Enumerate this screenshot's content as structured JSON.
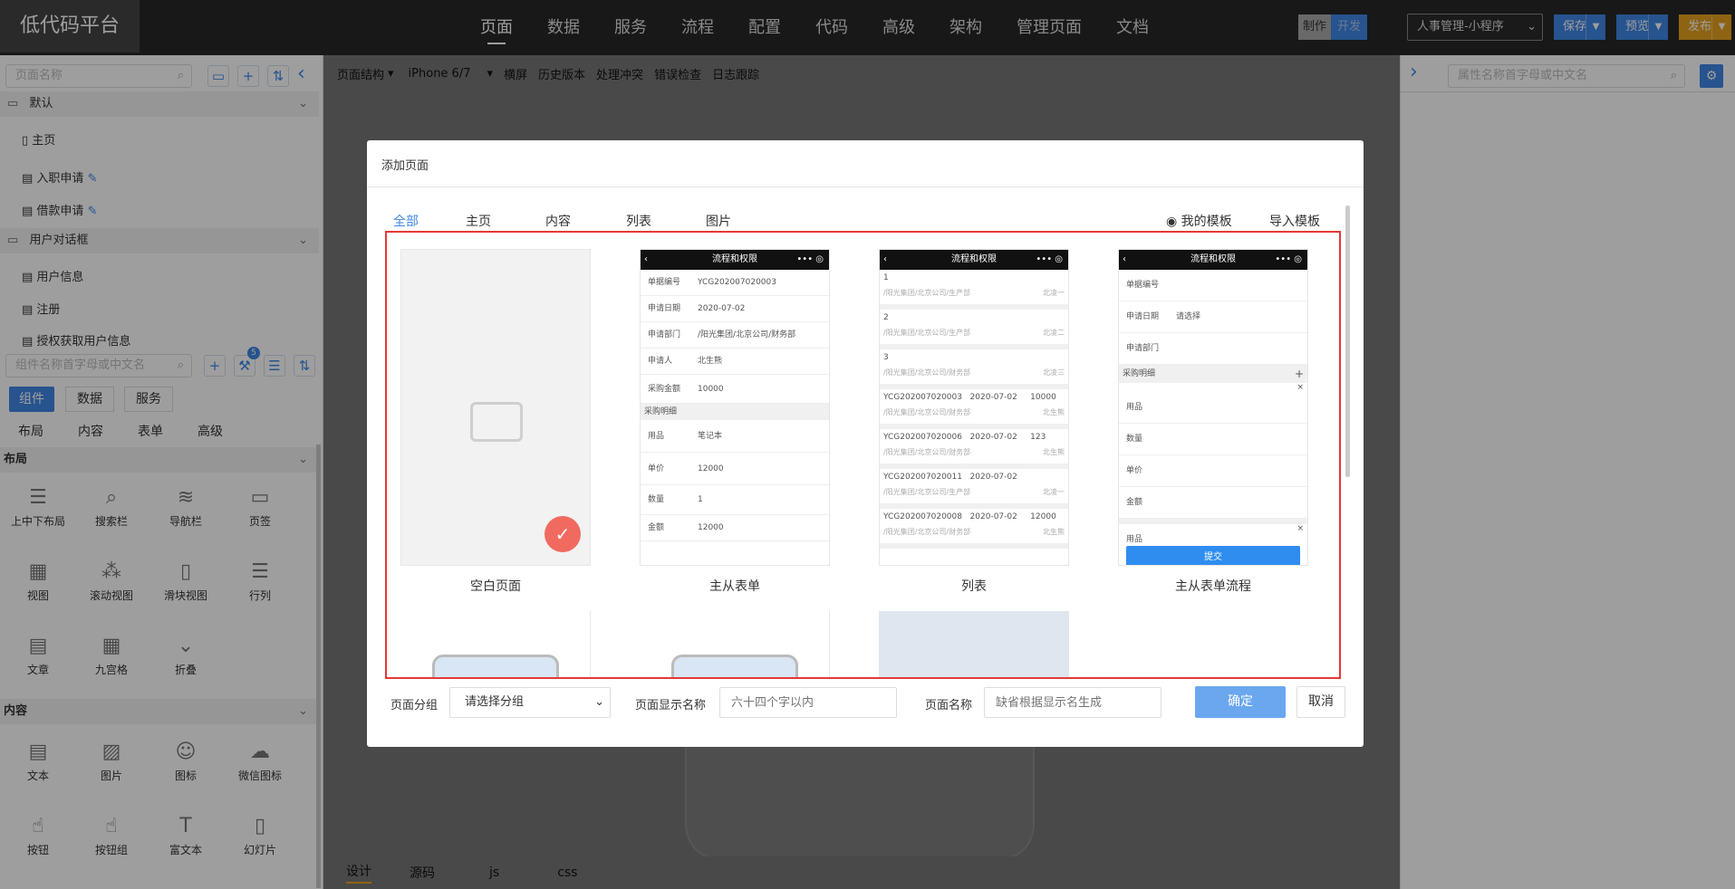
{
  "app": {
    "title": "低代码平台"
  },
  "nav": {
    "items": [
      "页面",
      "数据",
      "服务",
      "流程",
      "配置",
      "代码",
      "高级",
      "架构",
      "管理页面",
      "文档"
    ],
    "active_index": 0
  },
  "mode": {
    "make": "制作",
    "dev": "开发"
  },
  "project_select": {
    "value": "人事管理-小程序"
  },
  "actions": {
    "save": "保存",
    "preview": "预览",
    "publish": "发布"
  },
  "left": {
    "page_search_placeholder": "页面名称",
    "groups": [
      {
        "name": "默认",
        "pages": [
          "主页",
          "入职申请",
          "借款申请"
        ]
      },
      {
        "name": "用户对话框",
        "pages": [
          "用户信息",
          "注册",
          "授权获取用户信息"
        ]
      }
    ],
    "component_search_placeholder": "组件名称首字母或中文名",
    "badge": "5",
    "tabs": [
      "组件",
      "数据",
      "服务"
    ],
    "subtabs": [
      "布局",
      "内容",
      "表单",
      "高级"
    ],
    "layout_title": "布局",
    "layout_items": [
      "上中下布局",
      "搜索栏",
      "导航栏",
      "页签",
      "视图",
      "滚动视图",
      "滑块视图",
      "行列",
      "文章",
      "九宫格",
      "折叠"
    ],
    "content_title": "内容",
    "content_items": [
      "文本",
      "图片",
      "图标",
      "微信图标",
      "按钮",
      "按钮组",
      "富文本",
      "幻灯片"
    ]
  },
  "toolbar": {
    "structure": "页面结构",
    "device": "iPhone 6/7",
    "items": [
      "横屏",
      "历史版本",
      "处理冲突",
      "错误检查",
      "日志跟踪"
    ]
  },
  "bottom_tabs": [
    "设计",
    "源码",
    "js",
    "css"
  ],
  "right": {
    "search_placeholder": "属性名称首字母或中文名"
  },
  "modal": {
    "title": "添加页面",
    "tabs": [
      "全部",
      "主页",
      "内容",
      "列表",
      "图片"
    ],
    "my_templates": "我的模板",
    "import_templates": "导入模板",
    "cards": [
      "空白页面",
      "主从表单",
      "列表",
      "主从表单流程"
    ],
    "form": {
      "group_label": "页面分组",
      "group_placeholder": "请选择分组",
      "display_label": "页面显示名称",
      "display_placeholder": "六十四个字以内",
      "name_label": "页面名称",
      "name_placeholder": "缺省根据显示名生成"
    },
    "ok": "确定",
    "cancel": "取消"
  },
  "previews": {
    "form_title": "流程和权限",
    "form_rows": [
      [
        "单据编号",
        "YCG202007020003"
      ],
      [
        "申请日期",
        "2020-07-02"
      ],
      [
        "申请部门",
        "/阳光集团/北京公司/财务部"
      ],
      [
        "申请人",
        "北生熊"
      ],
      [
        "采购金额",
        "10000"
      ]
    ],
    "form_section": "采购明细",
    "form_detail": [
      [
        "用品",
        "笔记本"
      ],
      [
        "单价",
        "12000"
      ],
      [
        "数量",
        "1"
      ],
      [
        "金额",
        "12000"
      ]
    ],
    "list_rows": [
      {
        "main": "1",
        "sub": "/阳光集团/北京公司/生产部",
        "tag": "北凌一"
      },
      {
        "main": "2",
        "sub": "/阳光集团/北京公司/生产部",
        "tag": "北凌二"
      },
      {
        "main": "3",
        "sub": "/阳光集团/北京公司/财务部",
        "tag": "北凌三"
      },
      {
        "main": "YCG202007020003   2020-07-02     10000",
        "sub": "/阳光集团/北京公司/财务部",
        "tag": "北生熊"
      },
      {
        "main": "YCG202007020006   2020-07-02     123",
        "sub": "/阳光集团/北京公司/财务部",
        "tag": "北生熊"
      },
      {
        "main": "YCG202007020011   2020-07-02",
        "sub": "/阳光集团/北京公司/生产部",
        "tag": "北凌一"
      },
      {
        "main": "YCG202007020008   2020-07-02     12000",
        "sub": "/阳光集团/北京公司/财务部",
        "tag": "北生熊"
      }
    ],
    "flow_rows": [
      [
        "单据编号",
        ""
      ],
      [
        "申请日期",
        "请选择"
      ],
      [
        "申请部门",
        ""
      ]
    ],
    "flow_section": "采购明细",
    "flow_detail": [
      "用品",
      "数量",
      "单价",
      "金额"
    ],
    "flow_tail": "用品",
    "flow_submit": "提交"
  },
  "colors": {
    "accent": "#3f86e5",
    "danger": "#e53935",
    "check": "#f06a5f"
  }
}
